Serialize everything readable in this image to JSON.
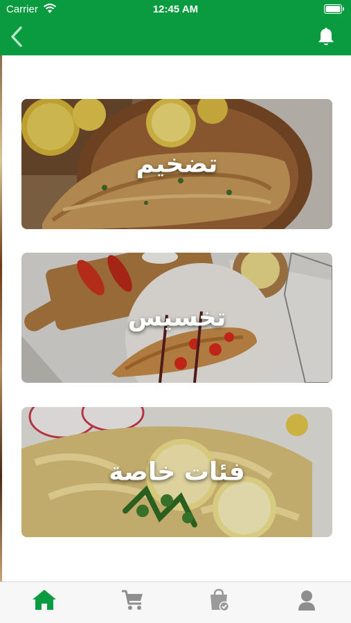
{
  "status_bar": {
    "carrier": "Carrier",
    "time": "12:45 AM"
  },
  "header": {
    "background_color": "#0a9a3f",
    "back_icon": "chevron-left-icon",
    "notification_icon": "bell-icon"
  },
  "categories": [
    {
      "label": "تضخيم",
      "image": "grilled-fish-with-lemon"
    },
    {
      "label": "تخسيس",
      "image": "fish-with-chili-on-plate"
    },
    {
      "label": "فئات خاصة",
      "image": "pasta-with-lemon-and-parsley"
    }
  ],
  "tabbar": {
    "active_color": "#0a9a3f",
    "inactive_color": "#8e8e8e",
    "tabs": [
      {
        "icon": "home-icon",
        "active": true
      },
      {
        "icon": "cart-icon",
        "active": false
      },
      {
        "icon": "orders-bag-icon",
        "active": false
      },
      {
        "icon": "profile-icon",
        "active": false
      }
    ]
  }
}
